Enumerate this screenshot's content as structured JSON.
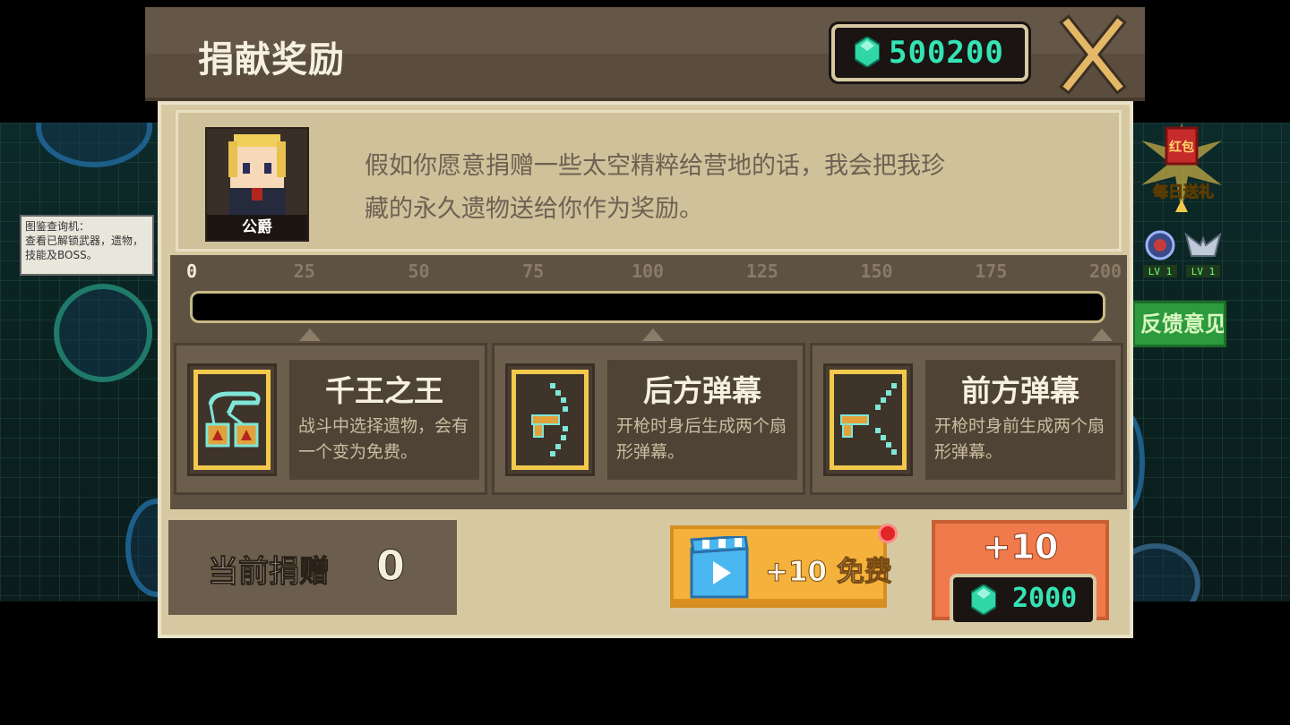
{
  "header": {
    "title": "捐献奖励",
    "gem_balance": "500200",
    "close_icon": "close-x-icon"
  },
  "background": {
    "tooltip_text": "图鉴查询机：\n查看已解锁武器，遗物，技能及BOSS。",
    "gift_label": "每日送礼",
    "gift_badge": "红包",
    "feedback_label": "反馈意见",
    "level_badges": [
      "LV 1",
      "LV 1"
    ]
  },
  "npc": {
    "name": "公爵",
    "dialogue": "假如你愿意捐赠一些太空精粹给营地的话，我会把我珍藏的永久遗物送给你作为奖励。"
  },
  "progress": {
    "ticks": [
      "0",
      "25",
      "50",
      "75",
      "100",
      "125",
      "150",
      "175",
      "200"
    ],
    "current": 0,
    "max": 200,
    "milestones": [
      25,
      100,
      200
    ]
  },
  "rewards": [
    {
      "title": "千王之王",
      "desc": "战斗中选择遗物，会有一个变为免费。",
      "icon": "hand-with-crates-icon"
    },
    {
      "title": "后方弹幕",
      "desc": "开枪时身后生成两个扇形弹幕。",
      "icon": "gun-rear-barrage-icon"
    },
    {
      "title": "前方弹幕",
      "desc": "开枪时身前生成两个扇形弹幕。",
      "icon": "gun-front-barrage-icon"
    }
  ],
  "donation": {
    "label": "当前捐赠",
    "value": "0"
  },
  "free_button": {
    "label": "+10 免费",
    "icon": "video-clapper-icon"
  },
  "donate_button": {
    "plus": "+10",
    "cost": "2000"
  },
  "colors": {
    "gem": "#34e4b5",
    "accent_yellow": "#f2c94c",
    "free_button": "#f4b23c",
    "donate_button": "#f07a4b"
  }
}
